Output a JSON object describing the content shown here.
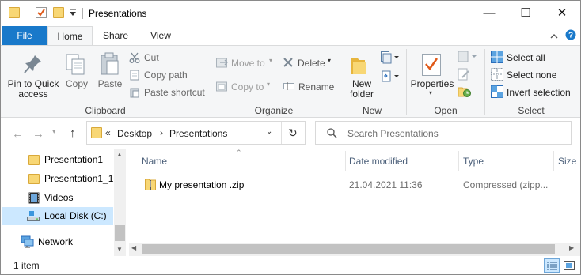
{
  "window": {
    "title": "Presentations",
    "controls": {
      "minimize": "—",
      "maximize": "☐",
      "close": "✕"
    }
  },
  "ribbon_tabs": [
    "File",
    "Home",
    "Share",
    "View"
  ],
  "ribbon": {
    "clipboard": {
      "pin_label_1": "Pin to Quick",
      "pin_label_2": "access",
      "copy": "Copy",
      "paste": "Paste",
      "cut": "Cut",
      "copy_path": "Copy path",
      "paste_shortcut": "Paste shortcut",
      "group": "Clipboard"
    },
    "organize": {
      "move_to": "Move to",
      "copy_to": "Copy to",
      "delete": "Delete",
      "rename": "Rename",
      "group": "Organize"
    },
    "new": {
      "new_folder_1": "New",
      "new_folder_2": "folder",
      "group": "New"
    },
    "open": {
      "properties": "Properties",
      "group": "Open"
    },
    "select": {
      "select_all": "Select all",
      "select_none": "Select none",
      "invert": "Invert selection",
      "group": "Select"
    }
  },
  "address": {
    "overflow": "«",
    "crumbs": [
      "Desktop",
      "Presentations"
    ],
    "search_placeholder": "Search Presentations"
  },
  "nav_pane": {
    "items": [
      "Presentation1",
      "Presentation1_1",
      "Videos",
      "Local Disk (C:)"
    ],
    "network": "Network"
  },
  "columns": {
    "name": "Name",
    "date": "Date modified",
    "type": "Type",
    "size": "Size"
  },
  "files": [
    {
      "name": "My presentation .zip",
      "date": "21.04.2021 11:36",
      "type": "Compressed (zipp..."
    }
  ],
  "status": {
    "count": "1 item"
  },
  "colors": {
    "accent": "#1979ca",
    "selected": "#cce8ff",
    "folder": "#f8d775"
  }
}
